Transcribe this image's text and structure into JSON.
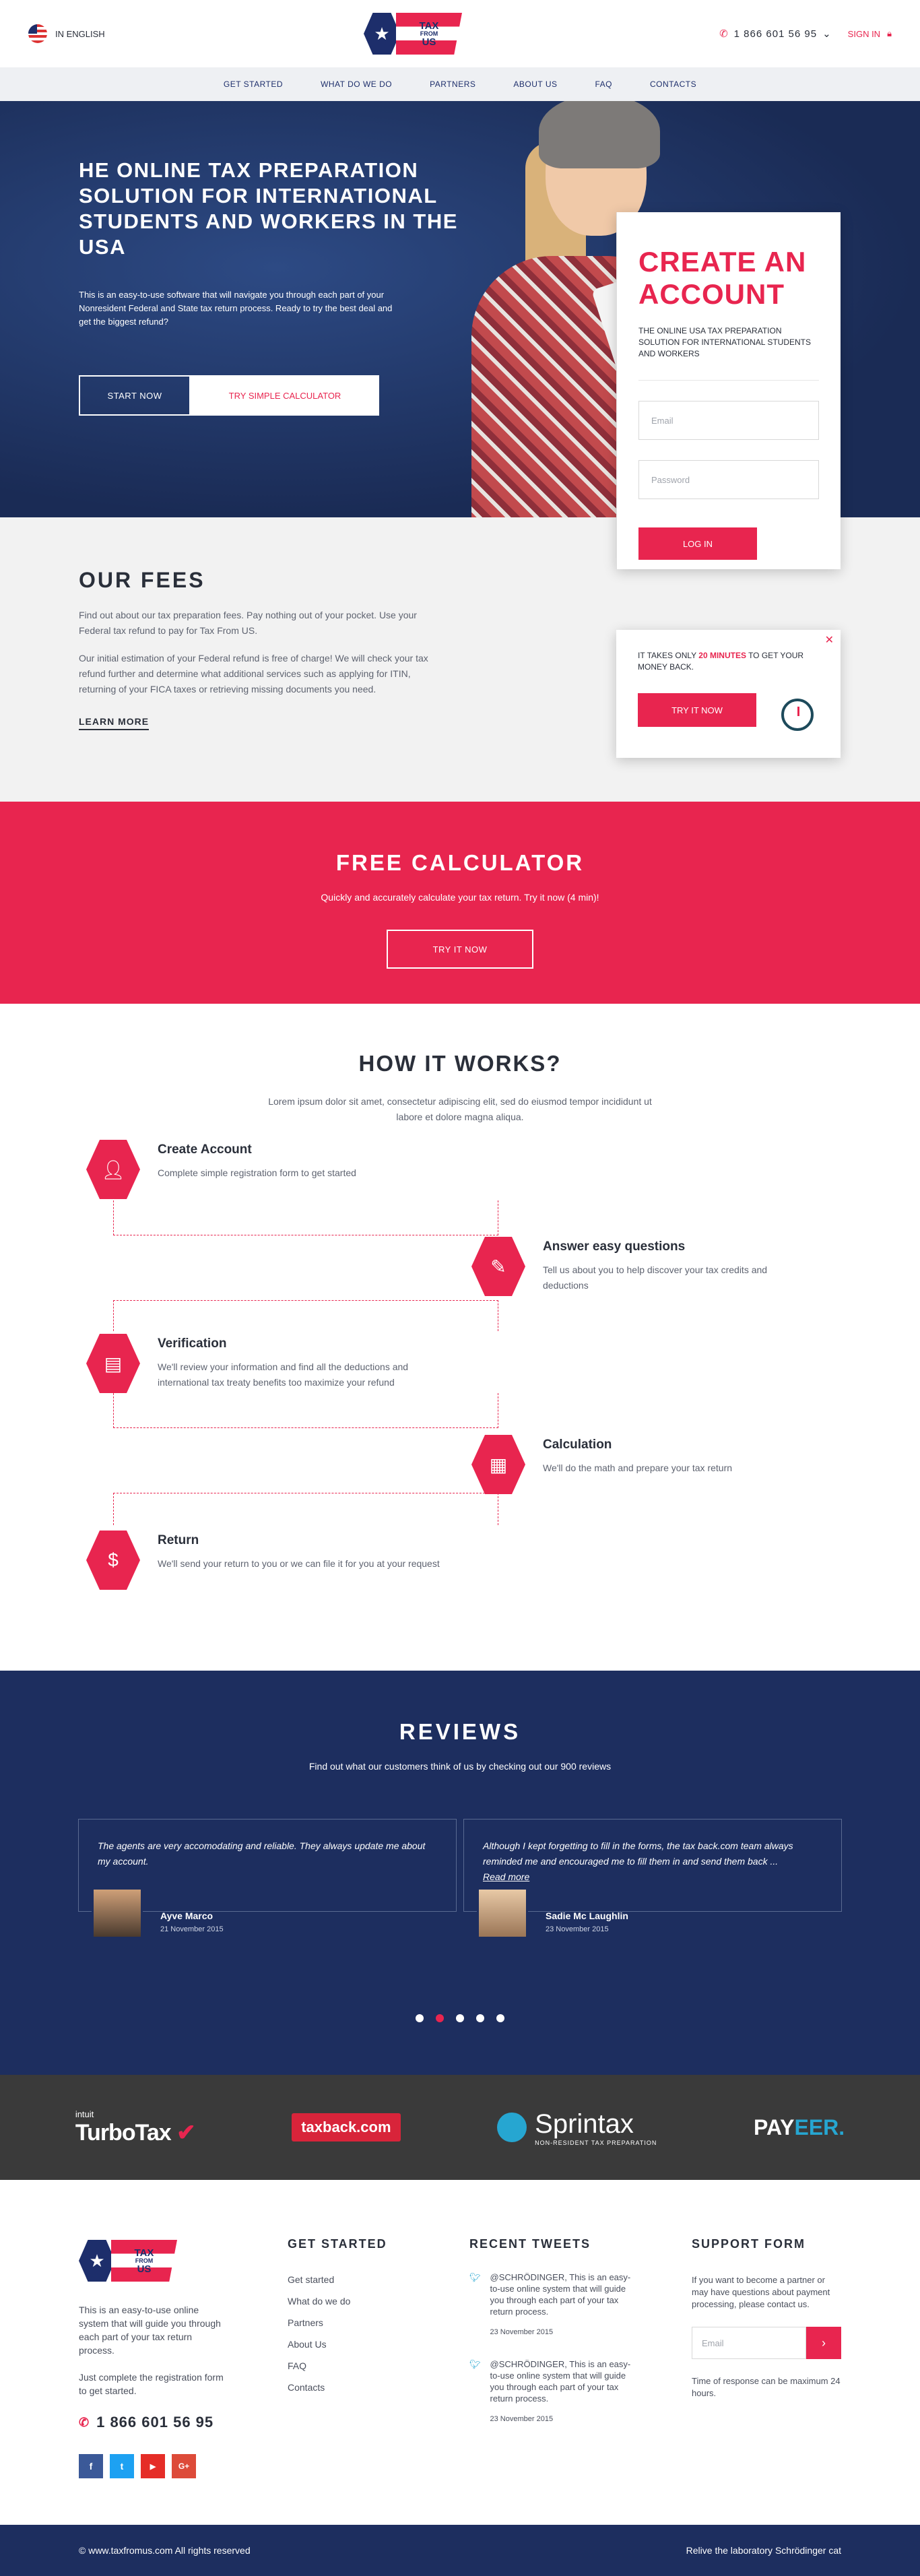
{
  "header": {
    "language": "IN ENGLISH",
    "logo": {
      "line1": "TAX",
      "line2": "FROM",
      "line3": "US",
      "tagline": "NON-RESIDENT TAX PREPARATION"
    },
    "phone": "1 866 601 56 95",
    "signin": "SIGN IN"
  },
  "nav": [
    "GET STARTED",
    "WHAT DO WE DO",
    "PARTNERS",
    "ABOUT US",
    "FAQ",
    "CONTACTS"
  ],
  "hero": {
    "title": "HE ONLINE TAX PREPARATION SOLUTION FOR INTERNATIONAL STUDENTS AND WORKERS IN THE USA",
    "text": "This is an easy-to-use software that will navigate you through each part of your Nonresident Federal and State tax return process. Ready to try the best deal and get the biggest refund?",
    "start_btn": "START NOW",
    "calc_btn": "TRY SIMPLE CALCULATOR"
  },
  "create": {
    "title": "CREATE AN ACCOUNT",
    "sub": "THE ONLINE USA TAX PREPARATION SOLUTION FOR INTERNATIONAL STUDENTS AND WORKERS",
    "email_ph": "Email",
    "password_ph": "Password",
    "login": "LOG IN"
  },
  "promo": {
    "pre": "IT TAKES ONLY ",
    "highlight": "20 MINUTES",
    "post": " TO GET YOUR MONEY BACK.",
    "btn": "TRY IT NOW"
  },
  "fees": {
    "title": "OUR FEES",
    "p1": "Find out about our tax preparation fees. Pay nothing out of your pocket. Use your Federal tax refund to pay for Tax From US.",
    "p2": "Our initial estimation of your Federal refund is free of charge! We will check your tax refund further and determine what additional services such as applying for ITIN, returning of your FICA taxes or retrieving missing documents you need.",
    "learn": "LEARN MORE"
  },
  "calculator": {
    "title": "FREE CALCULATOR",
    "text": "Quickly and accurately calculate your tax return. Try it now (4 min)!",
    "btn": "TRY IT NOW"
  },
  "how": {
    "title": "HOW IT WORKS?",
    "intro": "Lorem ipsum dolor sit amet, consectetur adipiscing elit, sed do eiusmod tempor incididunt ut labore et dolore magna aliqua.",
    "steps": [
      {
        "title": "Create Account",
        "text": "Complete simple registration form to get started"
      },
      {
        "title": "Answer easy questions",
        "text": "Tell us about you to help discover your tax credits and deductions"
      },
      {
        "title": "Verification",
        "text": "We'll review your information and find all the deductions and international tax treaty benefits too maximize your refund"
      },
      {
        "title": "Calculation",
        "text": "We'll do the math and prepare your tax return"
      },
      {
        "title": "Return",
        "text": "We'll send your return to you or we can file it for you at your request"
      }
    ]
  },
  "reviews": {
    "title": "REVIEWS",
    "sub": "Find out what our customers think of us by checking out our 900 reviews",
    "items": [
      {
        "text": "The agents are very accomodating and reliable. They always update me about my account.",
        "more": "",
        "name": "Ayve Marco",
        "date": "21 November 2015"
      },
      {
        "text": "Although I kept forgetting to fill in the forms, the tax back.com team always reminded me and encouraged me to fill them in and send them back ...",
        "more": "Read more",
        "name": "Sadie Mc Laughlin",
        "date": "23 November 2015"
      }
    ]
  },
  "partners": {
    "turbotax": "TurboTax",
    "intuit": "intuit",
    "taxback": "taxback.com",
    "sprintax": "Sprintax",
    "sprintax_sub": "NON-RESIDENT TAX PREPARATION",
    "payeer_a": "PAY",
    "payeer_b": "EER."
  },
  "footer": {
    "about1": "This is an easy-to-use online system that will guide you through each part of your tax return process.",
    "about2": "Just complete the registration form to get started.",
    "phone": "1 866 601 56 95",
    "social": [
      "f",
      "t",
      "▶",
      "G+"
    ],
    "col2_title": "GET STARTED",
    "links": [
      "Get started",
      "What do we do",
      "Partners",
      "About Us",
      "FAQ",
      "Contacts"
    ],
    "col3_title": "RECENT TWEETS",
    "tweets": [
      {
        "text": "@SCHRÖDINGER, This is an easy-to-use online system that will guide you through each part of your tax return process.",
        "date": "23 November 2015"
      },
      {
        "text": "@SCHRÖDINGER, This is an easy-to-use online system that will guide you through each part of your tax return process.",
        "date": "23 November 2015"
      }
    ],
    "col4_title": "SUPPORT FORM",
    "support_text": "If you want to become a partner or may have questions about payment processing, please contact us.",
    "email_ph": "Email",
    "support_note": "Time of response can be maximum 24 hours."
  },
  "copyright": {
    "left": "© www.taxfromus.com All rights reserved",
    "right": "Relive the laboratory Schrödinger cat"
  }
}
